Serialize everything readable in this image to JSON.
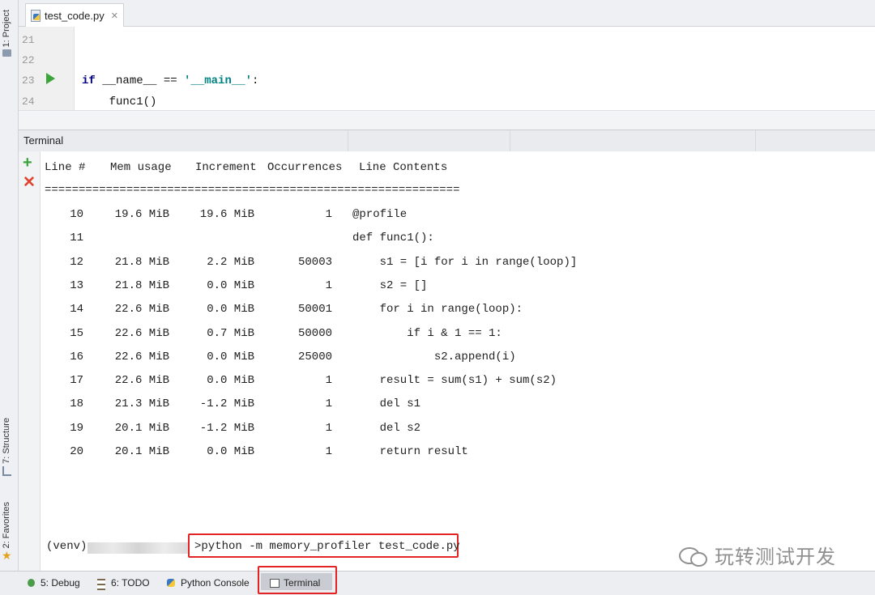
{
  "left_toolbar": {
    "project": "1: Project",
    "structure": "7: Structure",
    "favorites": "2: Favorites"
  },
  "editor": {
    "tab_label": "test_code.py",
    "lines": [
      {
        "num": "21",
        "code": ""
      },
      {
        "num": "22",
        "code": ""
      },
      {
        "num": "23",
        "code": "if __name__ == '__main__':"
      },
      {
        "num": "24",
        "code": "    func1()"
      }
    ]
  },
  "terminal": {
    "title": "Terminal",
    "headers": [
      "Line #",
      "Mem usage",
      "Increment",
      "Occurrences",
      "Line Contents"
    ],
    "separator": "=============================================================",
    "rows": [
      {
        "line": "10",
        "mem": "19.6 MiB",
        "inc": "19.6 MiB",
        "occ": "1",
        "content": "@profile"
      },
      {
        "line": "11",
        "mem": "",
        "inc": "",
        "occ": "",
        "content": "def func1():"
      },
      {
        "line": "12",
        "mem": "21.8 MiB",
        "inc": "2.2 MiB",
        "occ": "50003",
        "content": "    s1 = [i for i in range(loop)]"
      },
      {
        "line": "13",
        "mem": "21.8 MiB",
        "inc": "0.0 MiB",
        "occ": "1",
        "content": "    s2 = []"
      },
      {
        "line": "14",
        "mem": "22.6 MiB",
        "inc": "0.0 MiB",
        "occ": "50001",
        "content": "    for i in range(loop):"
      },
      {
        "line": "15",
        "mem": "22.6 MiB",
        "inc": "0.7 MiB",
        "occ": "50000",
        "content": "        if i & 1 == 1:"
      },
      {
        "line": "16",
        "mem": "22.6 MiB",
        "inc": "0.0 MiB",
        "occ": "25000",
        "content": "            s2.append(i)"
      },
      {
        "line": "17",
        "mem": "22.6 MiB",
        "inc": "0.0 MiB",
        "occ": "1",
        "content": "    result = sum(s1) + sum(s2)"
      },
      {
        "line": "18",
        "mem": "21.3 MiB",
        "inc": "-1.2 MiB",
        "occ": "1",
        "content": "    del s1"
      },
      {
        "line": "19",
        "mem": "20.1 MiB",
        "inc": "-1.2 MiB",
        "occ": "1",
        "content": "    del s2"
      },
      {
        "line": "20",
        "mem": "20.1 MiB",
        "inc": "0.0 MiB",
        "occ": "1",
        "content": "    return result"
      }
    ],
    "prompt": "(venv)",
    "command": ">python -m memory_profiler test_code.py"
  },
  "watermark": "玩转测试开发",
  "bottom_tabs": {
    "debug": "5: Debug",
    "todo": "6: TODO",
    "python_console": "Python Console",
    "terminal": "Terminal"
  },
  "colors": {
    "highlight_red": "#e22424",
    "keyword": "#000080",
    "string": "#008080",
    "run_green": "#3ba43b"
  }
}
